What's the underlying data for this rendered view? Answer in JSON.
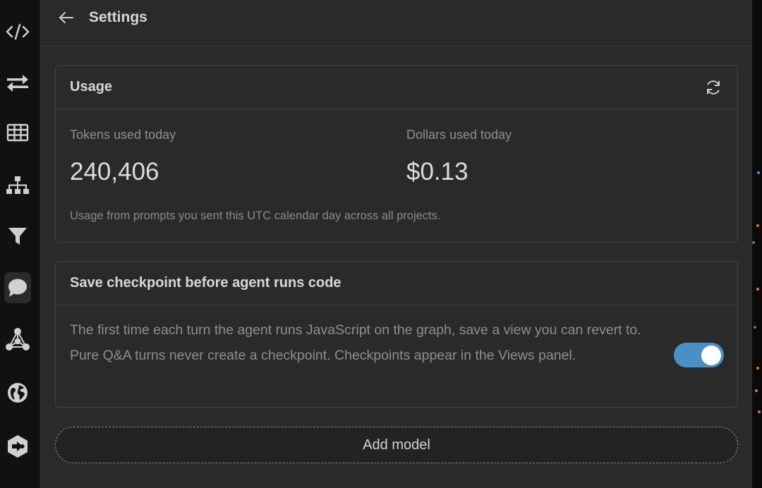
{
  "header": {
    "title": "Settings"
  },
  "sidebar": {
    "items": [
      {
        "name": "code-icon",
        "active": false
      },
      {
        "name": "swap-arrows-icon",
        "active": false
      },
      {
        "name": "table-icon",
        "active": false
      },
      {
        "name": "hierarchy-icon",
        "active": false
      },
      {
        "name": "filter-icon",
        "active": false
      },
      {
        "name": "chat-bubble-icon",
        "active": true
      },
      {
        "name": "graph-network-icon",
        "active": false
      },
      {
        "name": "globe-icon",
        "active": false
      },
      {
        "name": "plugin-icon",
        "active": false
      }
    ]
  },
  "usage": {
    "title": "Usage",
    "tokens_label": "Tokens used today",
    "tokens_value": "240,406",
    "dollars_label": "Dollars used today",
    "dollars_value": "$0.13",
    "note": "Usage from prompts you sent this UTC calendar day across all projects."
  },
  "checkpoint": {
    "title": "Save checkpoint before agent runs code",
    "description": "The first time each turn the agent runs JavaScript on the graph, save a view you can revert to. Pure Q&A turns never create a checkpoint. Checkpoints appear in the Views panel.",
    "enabled": true
  },
  "add_model": {
    "label": "Add model"
  },
  "colors": {
    "panel_bg": "#2a2a2a",
    "sidebar_bg": "#111111",
    "toggle_on": "#4b8fc6",
    "border": "#414141"
  }
}
